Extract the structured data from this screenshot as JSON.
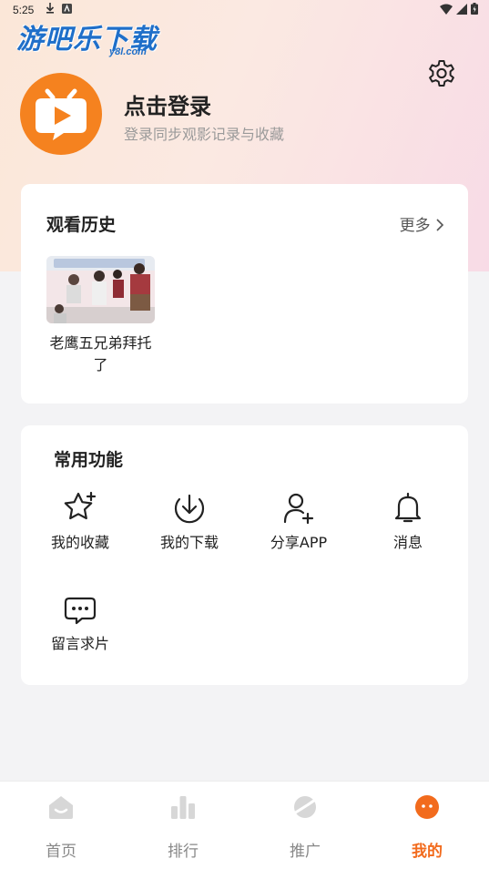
{
  "status_bar": {
    "time": "5:25"
  },
  "watermark": {
    "title": "游吧乐下载",
    "sub": "y8l.com"
  },
  "profile": {
    "login_title": "点击登录",
    "login_subtitle": "登录同步观影记录与收藏"
  },
  "history": {
    "title": "观看历史",
    "more_label": "更多",
    "items": [
      {
        "title": "老鹰五兄弟拜托了"
      }
    ]
  },
  "functions": {
    "title": "常用功能",
    "items": [
      {
        "label": "我的收藏",
        "icon": "star-icon"
      },
      {
        "label": "我的下载",
        "icon": "download-icon"
      },
      {
        "label": "分享APP",
        "icon": "add-user-icon"
      },
      {
        "label": "消息",
        "icon": "bell-icon"
      },
      {
        "label": "留言求片",
        "icon": "message-icon"
      }
    ]
  },
  "tabbar": {
    "items": [
      {
        "label": "首页",
        "icon": "home-icon"
      },
      {
        "label": "排行",
        "icon": "chart-icon"
      },
      {
        "label": "推广",
        "icon": "planet-icon"
      },
      {
        "label": "我的",
        "icon": "face-icon",
        "active": true
      }
    ]
  },
  "colors": {
    "accent": "#f26b1d",
    "avatar_bg": "#f5821f"
  }
}
